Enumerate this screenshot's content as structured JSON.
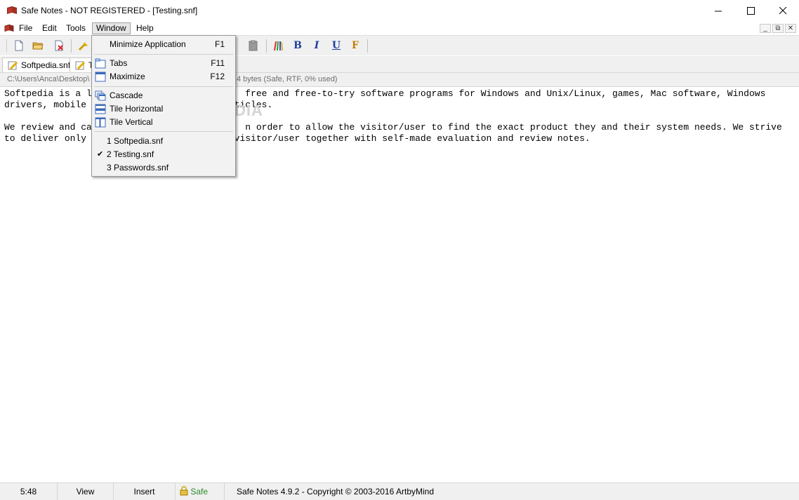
{
  "window": {
    "title": "Safe Notes - NOT REGISTERED - [Testing.snf]",
    "controls": {
      "minimize": "—",
      "maximize": "☐",
      "close": "✕"
    }
  },
  "menubar": {
    "items": [
      "File",
      "Edit",
      "Tools",
      "Window",
      "Help"
    ],
    "active": "Window",
    "mdi_controls": [
      "_",
      "⧉",
      "✕"
    ]
  },
  "toolbar": {
    "icons": [
      "new-document-icon",
      "open-folder-icon",
      "close-document-icon",
      "clean-brush-icon",
      "paste-icon",
      "colors-icon"
    ],
    "format_buttons": [
      "B",
      "I",
      "U",
      "F"
    ]
  },
  "tabs": [
    "Softpedia.snf",
    "T"
  ],
  "pathbar": {
    "path": "C:\\Users\\Anca\\Desktop\\",
    "info": "4 bytes (Safe, RTF, 0% used)"
  },
  "editor": {
    "text": "Softpedia is a l                            free and free-to-try software programs for Windows and Unix/Linux, games, Mac software, Windows drivers, mobile                           ticles.\n\nWe review and ca                            n order to allow the visitor/user to find the exact product they and their system needs. We strive to deliver only                           visitor/user together with self-made evaluation and review notes.",
    "watermark": "SOFTPEDIA"
  },
  "statusbar": {
    "time": "5:48",
    "view": "View",
    "mode": "Insert",
    "safe": "Safe",
    "copyright": "Safe Notes 4.9.2  -  Copyright © 2003-2016 ArtbyMind"
  },
  "window_menu": {
    "minimize": {
      "label": "Minimize Application",
      "key": "F1"
    },
    "tabs": {
      "label": "Tabs",
      "key": "F11"
    },
    "maximize": {
      "label": "Maximize",
      "key": "F12"
    },
    "cascade": {
      "label": "Cascade"
    },
    "tile_horizontal": {
      "label": "Tile Horizontal"
    },
    "tile_vertical": {
      "label": "Tile Vertical"
    },
    "recent": [
      {
        "label": "1 Softpedia.snf",
        "checked": false
      },
      {
        "label": "2 Testing.snf",
        "checked": true
      },
      {
        "label": "3 Passwords.snf",
        "checked": false
      }
    ]
  },
  "colors": {
    "accent": "#0078d7",
    "status_safe": "#2a8a2a",
    "bold": "#1f3f9f",
    "italic": "#1f3f9f",
    "underline": "#1f3f9f",
    "font": "#c08000"
  }
}
